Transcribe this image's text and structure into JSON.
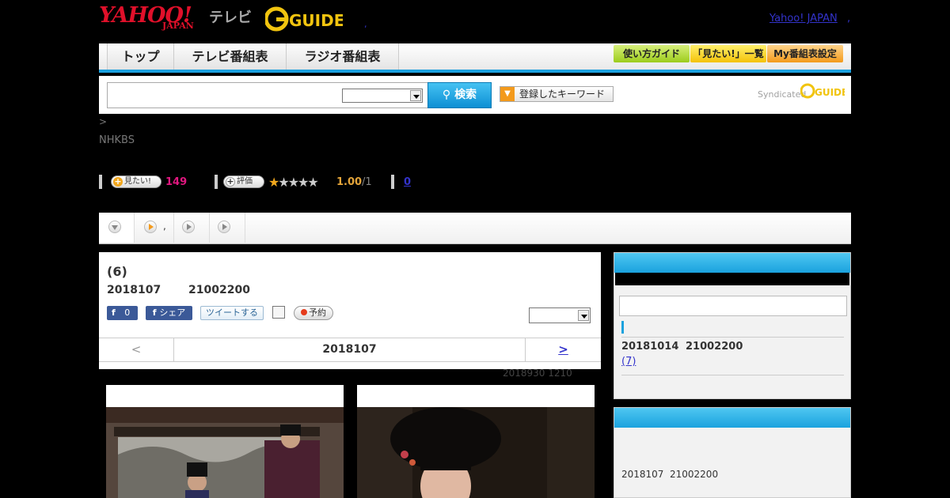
{
  "header": {
    "logo_yahoo": "YAHOO!",
    "logo_japan": "JAPAN",
    "logo_tv": "テレビ",
    "logo_gguide": "GUIDE",
    "separator": ",",
    "yahoo_japan_link": "Yahoo! JAPAN",
    "dot_link": ","
  },
  "nav": {
    "tabs": [
      "トップ",
      "テレビ番組表",
      "ラジオ番組表"
    ],
    "buttons": [
      "使い方ガイド",
      "「見たい!」一覧",
      "My番組表設定"
    ]
  },
  "search": {
    "input_value": "",
    "select_value": "",
    "button_label": "検索",
    "keyword_button": "登録したキーワード",
    "syndicated": "Syndicated",
    "syn_logo": "GUIDE"
  },
  "breadcrumb": ">",
  "channel": "NHKBS",
  "stats": {
    "want_label": "見たい!",
    "want_count": "149",
    "rate_label": "評価",
    "stars_on": 1,
    "stars_total": 5,
    "rating": "1.00",
    "rating_of": "/1",
    "review_count": "0"
  },
  "tabs": {
    "tab2_suffix": ","
  },
  "program": {
    "title": "(6)",
    "date": "2018107",
    "time": "21002200",
    "fb_like_count": "0",
    "fb_share": "シェア",
    "tweet": "ツイートする",
    "reserve": "予約",
    "select_value": ""
  },
  "pager": {
    "prev": "<",
    "current": "2018107",
    "next": ">"
  },
  "updated": "2018930  1210",
  "sidebar": {
    "next_date": "20181014",
    "next_time": "21002200",
    "next_link": "(7)",
    "box2_date": "2018107",
    "box2_time": "21002200"
  },
  "colors": {
    "accent": "#1ba0df",
    "link": "#3333cc",
    "want": "#e0177f",
    "rating": "#e5a53a"
  }
}
